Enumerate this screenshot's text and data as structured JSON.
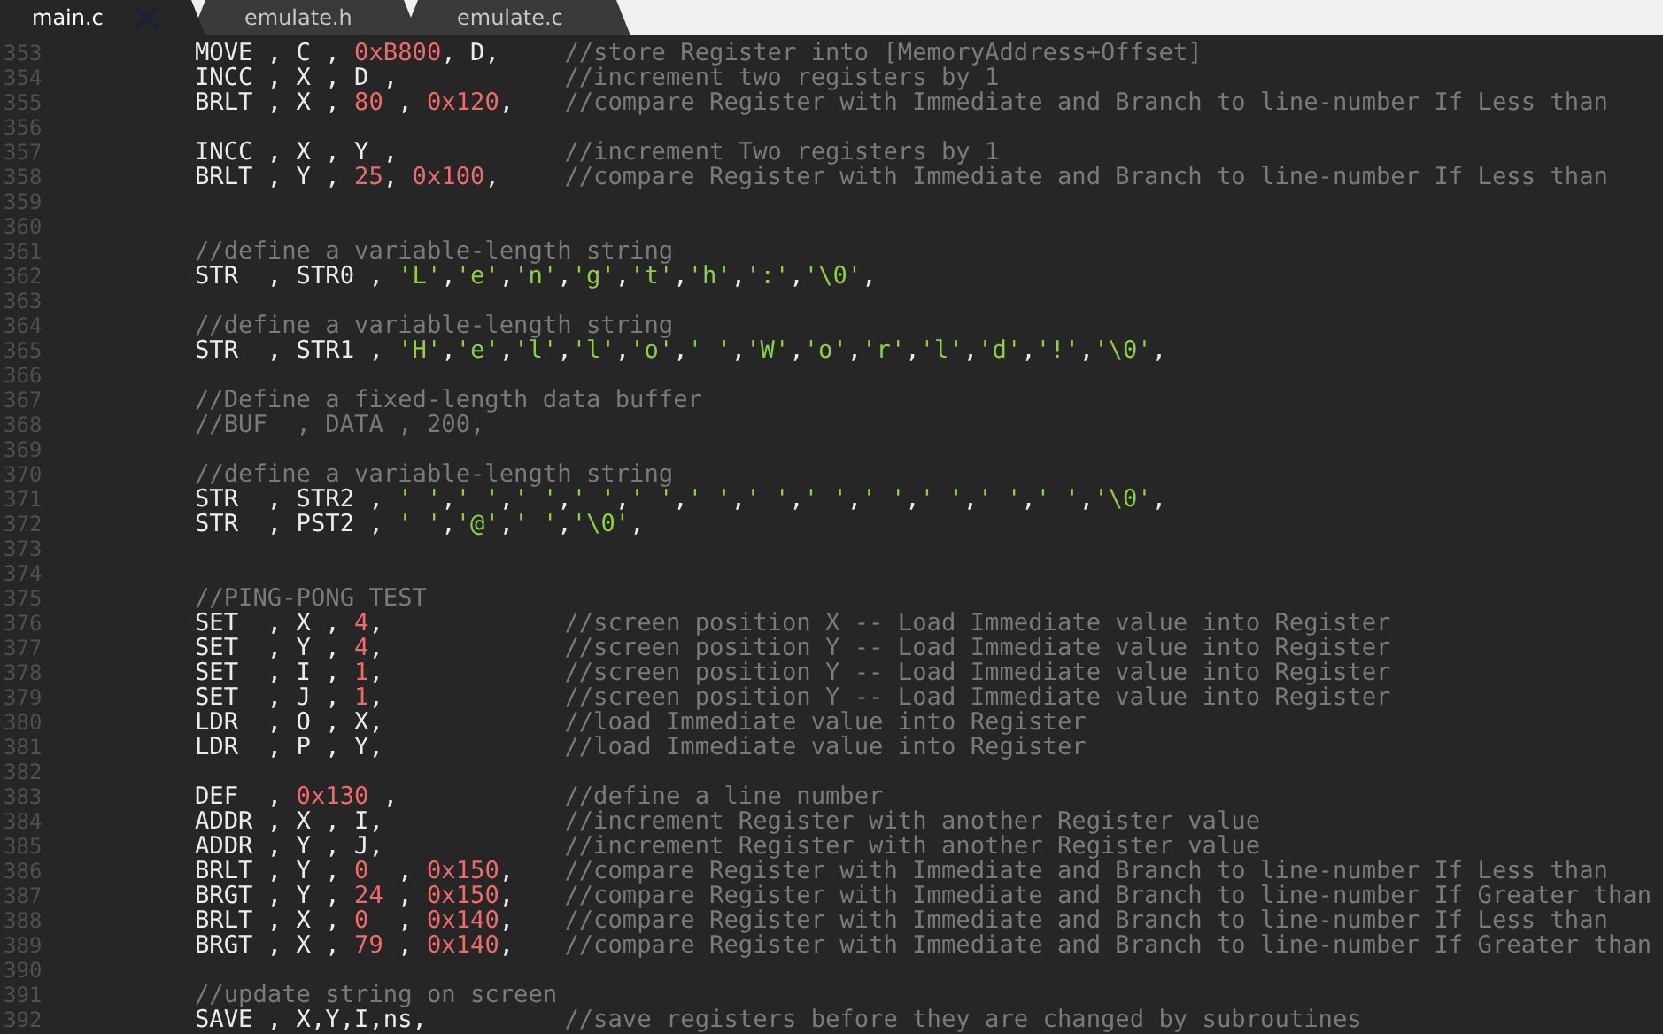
{
  "tabs": [
    {
      "label": "main.c",
      "selected": true
    },
    {
      "label": "emulate.h",
      "selected": false
    },
    {
      "label": "emulate.c",
      "selected": false
    }
  ],
  "editor": {
    "lines": [
      {
        "number": "353",
        "code": [
          {
            "kind": "plain",
            "text": "MOVE , C , "
          },
          {
            "kind": "num",
            "text": "0xB800"
          },
          {
            "kind": "plain",
            "text": ", D,"
          }
        ],
        "comment": "//store Register into [MemoryAddress+Offset]"
      },
      {
        "number": "354",
        "code": [
          {
            "kind": "plain",
            "text": "INCC , X , D ,"
          }
        ],
        "comment": "//increment two registers by 1"
      },
      {
        "number": "355",
        "code": [
          {
            "kind": "plain",
            "text": "BRLT , X , "
          },
          {
            "kind": "num",
            "text": "80"
          },
          {
            "kind": "plain",
            "text": " , "
          },
          {
            "kind": "num",
            "text": "0x120"
          },
          {
            "kind": "plain",
            "text": ","
          }
        ],
        "comment": "//compare Register with Immediate and Branch to line-number If Less than"
      },
      {
        "number": "356"
      },
      {
        "number": "357",
        "code": [
          {
            "kind": "plain",
            "text": "INCC , X , Y ,"
          }
        ],
        "comment": "//increment Two registers by 1"
      },
      {
        "number": "358",
        "code": [
          {
            "kind": "plain",
            "text": "BRLT , Y , "
          },
          {
            "kind": "num",
            "text": "25"
          },
          {
            "kind": "plain",
            "text": ", "
          },
          {
            "kind": "num",
            "text": "0x100"
          },
          {
            "kind": "plain",
            "text": ","
          }
        ],
        "comment": "//compare Register with Immediate and Branch to line-number If Less than"
      },
      {
        "number": "359"
      },
      {
        "number": "360"
      },
      {
        "number": "361",
        "code": [
          {
            "kind": "comment",
            "text": "//define a variable-length string"
          }
        ]
      },
      {
        "number": "362",
        "code": [
          {
            "kind": "plain",
            "text": "STR  , STR0 , "
          },
          {
            "kind": "str",
            "text": "'L','e','n','g','t','h',':','\\0',"
          }
        ]
      },
      {
        "number": "363"
      },
      {
        "number": "364",
        "code": [
          {
            "kind": "comment",
            "text": "//define a variable-length string"
          }
        ]
      },
      {
        "number": "365",
        "code": [
          {
            "kind": "plain",
            "text": "STR  , STR1 , "
          },
          {
            "kind": "str",
            "text": "'H','e','l','l','o',' ','W','o','r','l','d','!','\\0',"
          }
        ]
      },
      {
        "number": "366"
      },
      {
        "number": "367",
        "code": [
          {
            "kind": "comment",
            "text": "//Define a fixed-length data buffer"
          }
        ]
      },
      {
        "number": "368",
        "code": [
          {
            "kind": "comment",
            "text": "//BUF  , DATA , 200,"
          }
        ]
      },
      {
        "number": "369"
      },
      {
        "number": "370",
        "code": [
          {
            "kind": "comment",
            "text": "//define a variable-length string"
          }
        ]
      },
      {
        "number": "371",
        "code": [
          {
            "kind": "plain",
            "text": "STR  , STR2 , "
          },
          {
            "kind": "str",
            "text": "' ',' ',' ',' ',' ',' ',' ',' ',' ',' ',' ',' ','\\0',"
          }
        ]
      },
      {
        "number": "372",
        "code": [
          {
            "kind": "plain",
            "text": "STR  , PST2 , "
          },
          {
            "kind": "str",
            "text": "' ','@',' ','\\0',"
          }
        ]
      },
      {
        "number": "373"
      },
      {
        "number": "374"
      },
      {
        "number": "375",
        "code": [
          {
            "kind": "comment",
            "text": "//PING-PONG TEST"
          }
        ]
      },
      {
        "number": "376",
        "code": [
          {
            "kind": "plain",
            "text": "SET  , X , "
          },
          {
            "kind": "num",
            "text": "4"
          },
          {
            "kind": "plain",
            "text": ","
          }
        ],
        "comment": "//screen position X -- Load Immediate value into Register"
      },
      {
        "number": "377",
        "code": [
          {
            "kind": "plain",
            "text": "SET  , Y , "
          },
          {
            "kind": "num",
            "text": "4"
          },
          {
            "kind": "plain",
            "text": ","
          }
        ],
        "comment": "//screen position Y -- Load Immediate value into Register"
      },
      {
        "number": "378",
        "code": [
          {
            "kind": "plain",
            "text": "SET  , I , "
          },
          {
            "kind": "num",
            "text": "1"
          },
          {
            "kind": "plain",
            "text": ","
          }
        ],
        "comment": "//screen position Y -- Load Immediate value into Register"
      },
      {
        "number": "379",
        "code": [
          {
            "kind": "plain",
            "text": "SET  , J , "
          },
          {
            "kind": "num",
            "text": "1"
          },
          {
            "kind": "plain",
            "text": ","
          }
        ],
        "comment": "//screen position Y -- Load Immediate value into Register"
      },
      {
        "number": "380",
        "code": [
          {
            "kind": "plain",
            "text": "LDR  , O , X,"
          }
        ],
        "comment": "//load Immediate value into Register"
      },
      {
        "number": "381",
        "code": [
          {
            "kind": "plain",
            "text": "LDR  , P , Y,"
          }
        ],
        "comment": "//load Immediate value into Register"
      },
      {
        "number": "382"
      },
      {
        "number": "383",
        "code": [
          {
            "kind": "plain",
            "text": "DEF  , "
          },
          {
            "kind": "num",
            "text": "0x130"
          },
          {
            "kind": "plain",
            "text": " ,"
          }
        ],
        "comment": "//define a line number"
      },
      {
        "number": "384",
        "code": [
          {
            "kind": "plain",
            "text": "ADDR , X , I,"
          }
        ],
        "comment": "//increment Register with another Register value"
      },
      {
        "number": "385",
        "code": [
          {
            "kind": "plain",
            "text": "ADDR , Y , J,"
          }
        ],
        "comment": "//increment Register with another Register value"
      },
      {
        "number": "386",
        "code": [
          {
            "kind": "plain",
            "text": "BRLT , Y , "
          },
          {
            "kind": "num",
            "text": "0"
          },
          {
            "kind": "plain",
            "text": "  , "
          },
          {
            "kind": "num",
            "text": "0x150"
          },
          {
            "kind": "plain",
            "text": ","
          }
        ],
        "comment": "//compare Register with Immediate and Branch to line-number If Less than"
      },
      {
        "number": "387",
        "code": [
          {
            "kind": "plain",
            "text": "BRGT , Y , "
          },
          {
            "kind": "num",
            "text": "24"
          },
          {
            "kind": "plain",
            "text": " , "
          },
          {
            "kind": "num",
            "text": "0x150"
          },
          {
            "kind": "plain",
            "text": ","
          }
        ],
        "comment": "//compare Register with Immediate and Branch to line-number If Greater than"
      },
      {
        "number": "388",
        "code": [
          {
            "kind": "plain",
            "text": "BRLT , X , "
          },
          {
            "kind": "num",
            "text": "0"
          },
          {
            "kind": "plain",
            "text": "  , "
          },
          {
            "kind": "num",
            "text": "0x140"
          },
          {
            "kind": "plain",
            "text": ","
          }
        ],
        "comment": "//compare Register with Immediate and Branch to line-number If Less than"
      },
      {
        "number": "389",
        "code": [
          {
            "kind": "plain",
            "text": "BRGT , X , "
          },
          {
            "kind": "num",
            "text": "79"
          },
          {
            "kind": "plain",
            "text": " , "
          },
          {
            "kind": "num",
            "text": "0x140"
          },
          {
            "kind": "plain",
            "text": ","
          }
        ],
        "comment": "//compare Register with Immediate and Branch to line-number If Greater than"
      },
      {
        "number": "390"
      },
      {
        "number": "391",
        "code": [
          {
            "kind": "comment",
            "text": "//update string on screen"
          }
        ]
      },
      {
        "number": "392",
        "code": [
          {
            "kind": "plain",
            "text": "SAVE , X,Y,I,ns,"
          }
        ],
        "comment": "//save registers before they are changed by subroutines"
      }
    ]
  }
}
